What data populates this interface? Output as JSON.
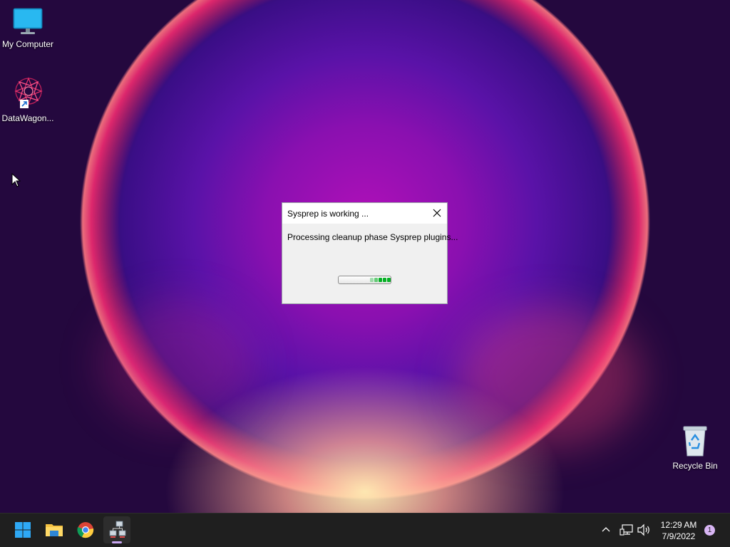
{
  "desktop": {
    "icons": [
      {
        "label": "My Computer",
        "icon": "monitor-icon"
      },
      {
        "label": "DataWagon...",
        "icon": "datawagon-shortcut-icon"
      },
      {
        "label": "Recycle Bin",
        "icon": "recycle-bin-icon"
      }
    ]
  },
  "dialog": {
    "title": "Sysprep is working ...",
    "message": "Processing cleanup phase Sysprep plugins...",
    "close_icon": "close-icon",
    "progress": "indeterminate (marquee)"
  },
  "taskbar": {
    "apps": [
      {
        "name": "Start",
        "icon": "windows-start-icon"
      },
      {
        "name": "File Explorer",
        "icon": "folder-icon"
      },
      {
        "name": "Google Chrome",
        "icon": "chrome-icon"
      },
      {
        "name": "Sysprep",
        "icon": "network-computers-icon",
        "active": true
      }
    ],
    "tray": {
      "chevron_icon": "chevron-up-icon",
      "network_icon": "network-icon",
      "volume_icon": "volume-icon",
      "time": "12:29 AM",
      "date": "7/9/2022",
      "notification_count": "1"
    }
  },
  "colors": {
    "progress_green": "#06b025",
    "taskbar": "#1f1f1f",
    "active_indicator": "#c8a6f0"
  }
}
